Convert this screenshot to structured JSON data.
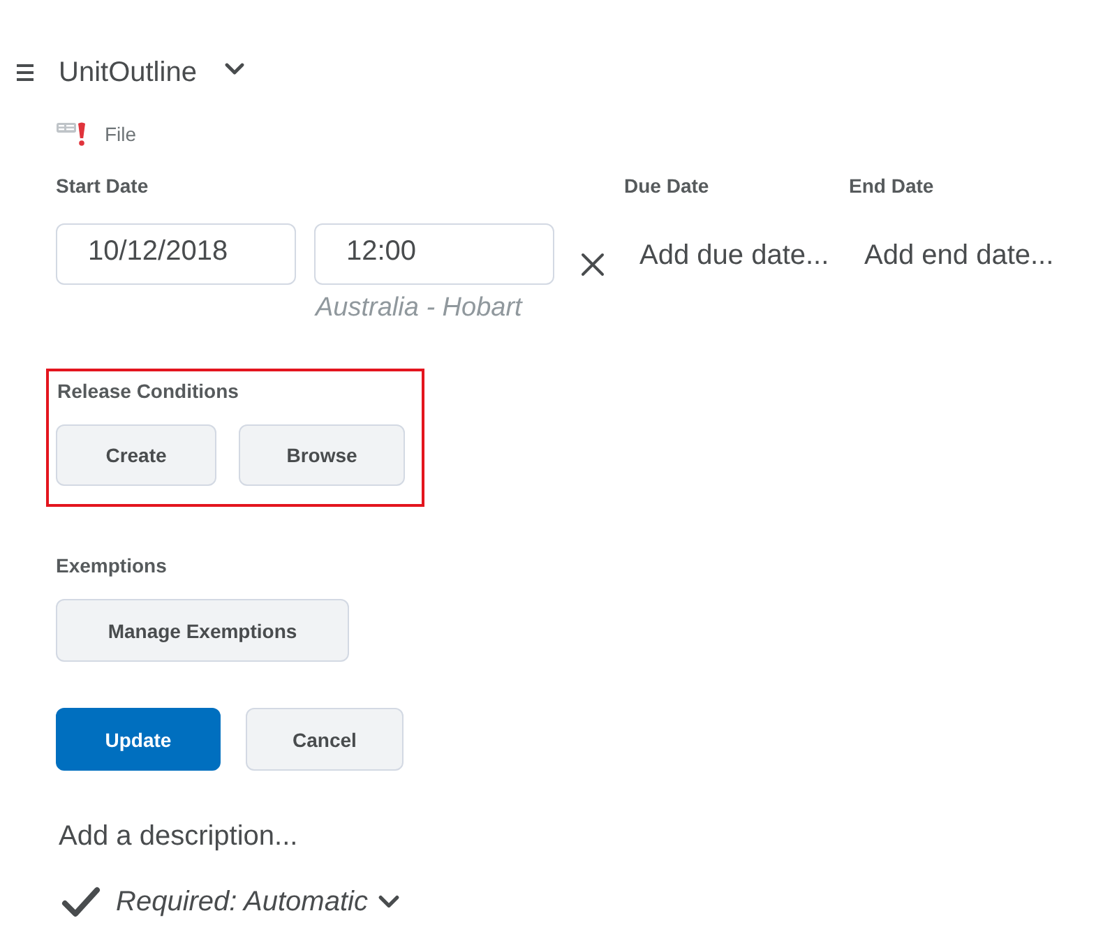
{
  "header": {
    "title": "UnitOutline",
    "type_label": "File"
  },
  "start_date": {
    "label": "Start Date",
    "date": "10/12/2018",
    "time": "12:00",
    "timezone": "Australia - Hobart"
  },
  "due_date": {
    "label": "Due Date",
    "link": "Add due date..."
  },
  "end_date": {
    "label": "End Date",
    "link": "Add end date..."
  },
  "release_conditions": {
    "label": "Release Conditions",
    "highlighted": true,
    "buttons": [
      "Create",
      "Browse"
    ]
  },
  "exemptions": {
    "label": "Exemptions",
    "buttons": [
      "Manage Exemptions"
    ]
  },
  "actions": [
    {
      "label": "Update",
      "kind": "primary"
    },
    {
      "label": "Cancel",
      "kind": "secondary"
    }
  ],
  "description": {
    "link": "Add a description..."
  },
  "completion": {
    "label": "Required: Automatic"
  }
}
